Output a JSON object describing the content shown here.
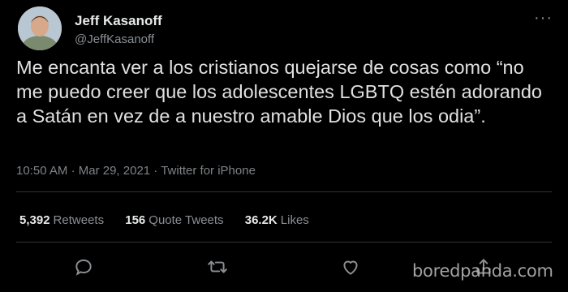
{
  "tweet": {
    "author": {
      "name": "Jeff Kasanoff",
      "handle": "@JeffKasanoff"
    },
    "text": "Me encanta ver a los cristianos quejarse de cosas como “no me puedo creer que los adolescentes LGBTQ estén adorando a Satán en vez de a nuestro amable Dios que los odia”.",
    "meta": {
      "time": "10:50 AM",
      "date": "Mar 29, 2021",
      "source": "Twitter for iPhone",
      "separator": "·"
    },
    "stats": [
      {
        "count": "5,392",
        "label": "Retweets"
      },
      {
        "count": "156",
        "label": "Quote Tweets"
      },
      {
        "count": "36.2K",
        "label": "Likes"
      }
    ],
    "actions": [
      {
        "name": "reply-icon"
      },
      {
        "name": "retweet-icon"
      },
      {
        "name": "like-icon"
      },
      {
        "name": "share-icon"
      }
    ]
  },
  "watermark": "boredpanda.com",
  "colors": {
    "background": "#000000",
    "text": "#e0e0e0",
    "secondary": "#8b8f93",
    "divider": "#2f3336"
  }
}
